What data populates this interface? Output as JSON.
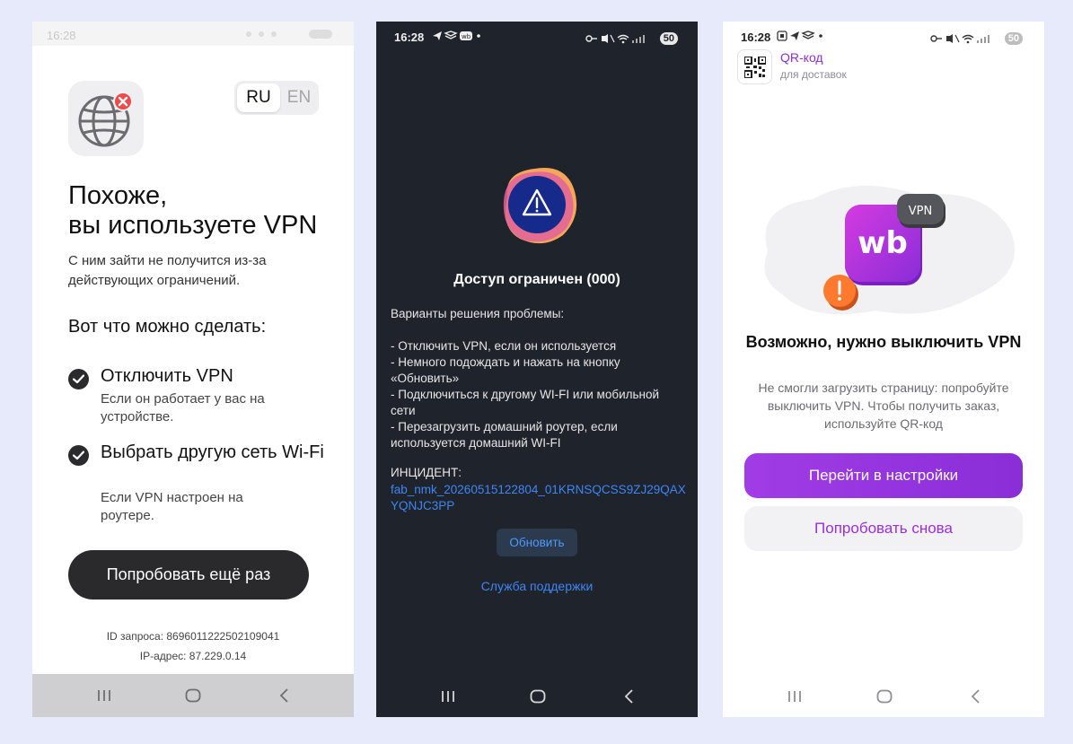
{
  "p1": {
    "status": {
      "time": "16:28"
    },
    "lang": {
      "ru": "RU",
      "en": "EN"
    },
    "title_line1": "Похоже,",
    "title_line2": "вы используете VPN",
    "subtitle": "С ним зайти не получится из-за действующих ограничений.",
    "section_title": "Вот что можно сделать:",
    "options": [
      {
        "title": "Отключить VPN",
        "desc": "Если он работает у вас на устройстве."
      },
      {
        "title": "Выбрать другую сеть Wi-Fi",
        "desc": "Если VPN настроен на роутере."
      }
    ],
    "retry_button": "Попробовать ещё раз",
    "request_id": "ID запроса: 8696011222502109041",
    "ip_address": "IP-адрес: 87.229.0.14",
    "icons": {
      "globe": "globe-blocked-icon",
      "check": "check-circle-icon"
    }
  },
  "p2": {
    "status": {
      "time": "16:28",
      "battery": "50"
    },
    "headline": "Доступ ограничен (000)",
    "intro": "Варианты решения проблемы:",
    "steps": [
      "- Отключить VPN, если он используется",
      "- Немного подождать и нажать на кнопку «Обновить»",
      "- Подключиться к другому WI-FI или мобильной сети",
      "- Перезагрузить домашний роутер, если используется домашний WI-FI"
    ],
    "incident_label": "ИНЦИДЕНТ:",
    "incident_id": "fab_nmk_20260515122804_01KRNSQCSS9ZJ29QAXYQNJC3PP",
    "refresh_button": "Обновить",
    "support_link": "Служба поддержки",
    "colors": {
      "background": "#1f232b",
      "link": "#3d86f5"
    }
  },
  "p3": {
    "status": {
      "time": "16:28",
      "battery": "50"
    },
    "qr": {
      "title": "QR-код",
      "subtitle": "для доставок"
    },
    "badge_vpn": "VPN",
    "logo_text": "wb",
    "headline": "Возможно, нужно выключить VPN",
    "body": "Не смогли загрузить страницу: попробуйте выключить VPN. Чтобы получить заказ, используйте QR-код",
    "primary_button": "Перейти в настройки",
    "secondary_button": "Попробовать снова",
    "colors": {
      "accent": "#9b2fd9"
    }
  }
}
